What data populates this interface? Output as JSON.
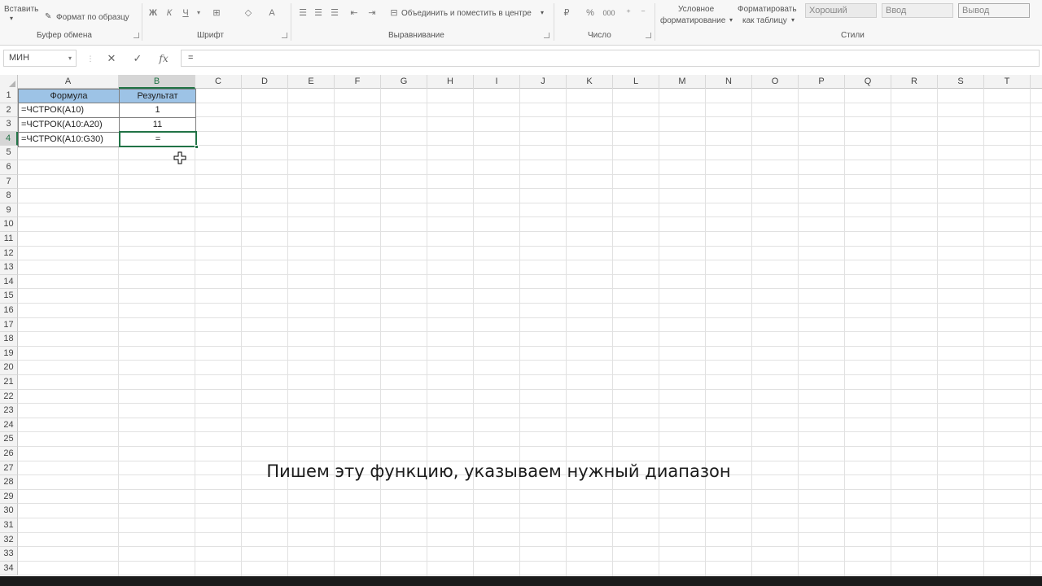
{
  "ribbon": {
    "paste_label": "Вставить",
    "format_painter_label": "Формат по образцу",
    "clipboard_group": "Буфер обмена",
    "font_group": "Шрифт",
    "bold_label": "Ж",
    "italic_label": "К",
    "underline_label": "Ч",
    "align_group": "Выравнивание",
    "merge_label": "Объединить и поместить в центре",
    "number_group": "Число",
    "percent_label": "%",
    "thousands_label": "000",
    "cond_format_label_1": "Условное",
    "cond_format_label_2": "форматирование",
    "format_table_label_1": "Форматировать",
    "format_table_label_2": "как таблицу",
    "styles_group": "Стили",
    "style_good": "Хороший",
    "style_input": "Ввод",
    "style_output": "Вывод"
  },
  "formula_bar": {
    "name_box": "МИН",
    "cancel_icon": "✕",
    "enter_icon": "✓",
    "fx_label": "fx",
    "formula": "="
  },
  "grid": {
    "columns": [
      "A",
      "B",
      "C",
      "D",
      "E",
      "F",
      "G",
      "H",
      "I",
      "J",
      "K",
      "L",
      "M",
      "N",
      "O",
      "P",
      "Q",
      "R",
      "S",
      "T"
    ],
    "rows": [
      "1",
      "2",
      "3",
      "4",
      "5",
      "6",
      "7",
      "8",
      "9",
      "10",
      "11",
      "12",
      "13",
      "14",
      "15",
      "16",
      "17",
      "18",
      "19",
      "20",
      "21",
      "22",
      "23",
      "24",
      "25",
      "26",
      "27",
      "28",
      "29",
      "30",
      "31",
      "32",
      "33",
      "34"
    ],
    "header_a": "Формула",
    "header_b": "Результат",
    "a2": "=ЧСТРОК(A10)",
    "b2": "1",
    "a3": "=ЧСТРОК(A10:A20)",
    "b3": "11",
    "a4": "=ЧСТРОК(A10:G30)",
    "b4": "=",
    "header_fill": "#9dc3e6",
    "selection_color": "#217346"
  },
  "subtitle": "Пишем эту функцию, указываем нужный диапазон"
}
